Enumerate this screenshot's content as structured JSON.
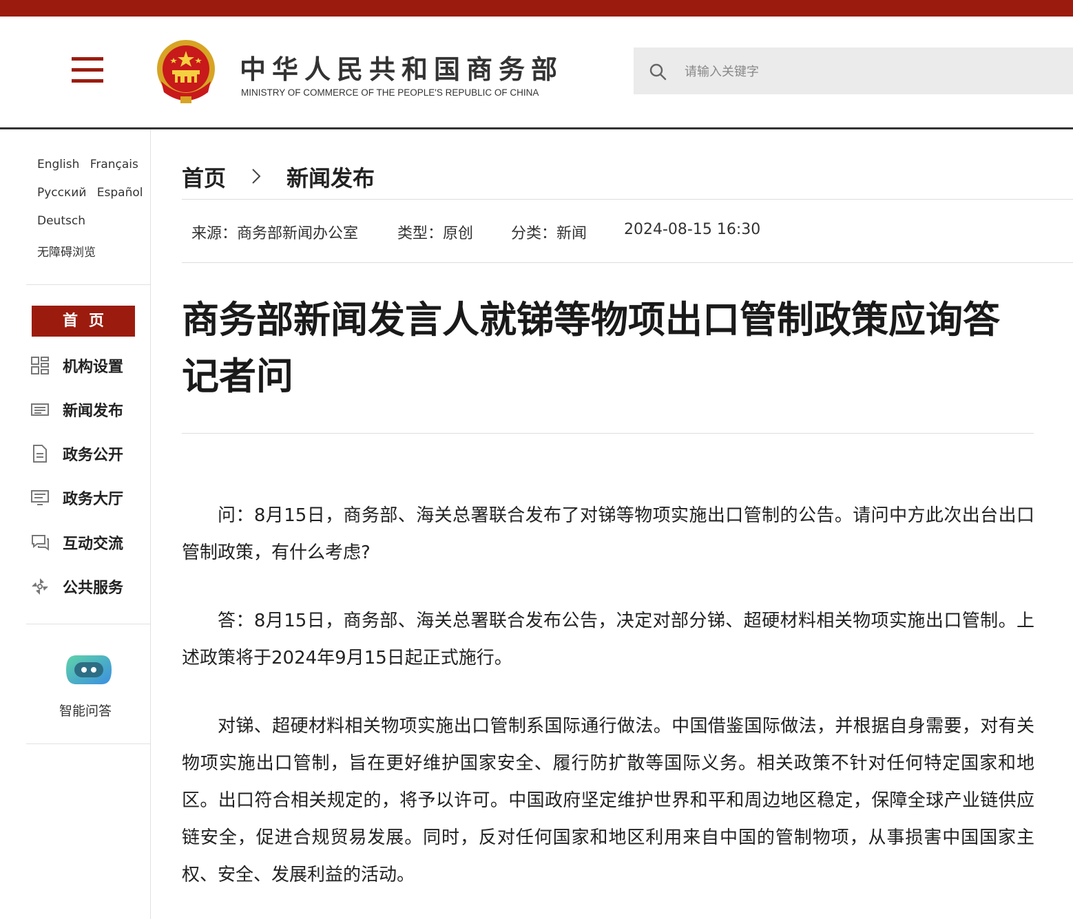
{
  "site": {
    "name_cn": "中华人民共和国商务部",
    "name_en": "MINISTRY OF COMMERCE OF THE PEOPLE'S REPUBLIC OF CHINA",
    "brand_color": "#9b1c0e"
  },
  "search": {
    "placeholder": "请输入关键字",
    "value": ""
  },
  "languages": {
    "english": "English",
    "french": "Français",
    "russian": "Русский",
    "spanish": "Español",
    "german": "Deutsch",
    "accessibility": "无障碍浏览"
  },
  "nav": {
    "home": "首页",
    "items": [
      {
        "label": "机构设置",
        "icon": "org-grid-icon"
      },
      {
        "label": "新闻发布",
        "icon": "news-list-icon"
      },
      {
        "label": "政务公开",
        "icon": "document-icon"
      },
      {
        "label": "政务大厅",
        "icon": "monitor-icon"
      },
      {
        "label": "互动交流",
        "icon": "chat-icon"
      },
      {
        "label": "公共服务",
        "icon": "service-icon"
      }
    ]
  },
  "assistant": {
    "label": "智能问答",
    "icon": "robot-icon"
  },
  "breadcrumb": {
    "home": "首页",
    "current": "新闻发布"
  },
  "meta": {
    "source": "来源：商务部新闻办公室",
    "type": "类型：原创",
    "category": "分类：新闻",
    "datetime": "2024-08-15 16:30"
  },
  "article": {
    "title": "商务部新闻发言人就锑等物项出口管制政策应询答记者问",
    "paragraphs": [
      "问：8月15日，商务部、海关总署联合发布了对锑等物项实施出口管制的公告。请问中方此次出台出口管制政策，有什么考虑?",
      "答：8月15日，商务部、海关总署联合发布公告，决定对部分锑、超硬材料相关物项实施出口管制。上述政策将于2024年9月15日起正式施行。",
      "对锑、超硬材料相关物项实施出口管制系国际通行做法。中国借鉴国际做法，并根据自身需要，对有关物项实施出口管制，旨在更好维护国家安全、履行防扩散等国际义务。相关政策不针对任何特定国家和地区。出口符合相关规定的，将予以许可。中国政府坚定维护世界和平和周边地区稳定，保障全球产业链供应链安全，促进合规贸易发展。同时，反对任何国家和地区利用来自中国的管制物项，从事损害中国国家主权、安全、发展利益的活动。"
    ]
  }
}
